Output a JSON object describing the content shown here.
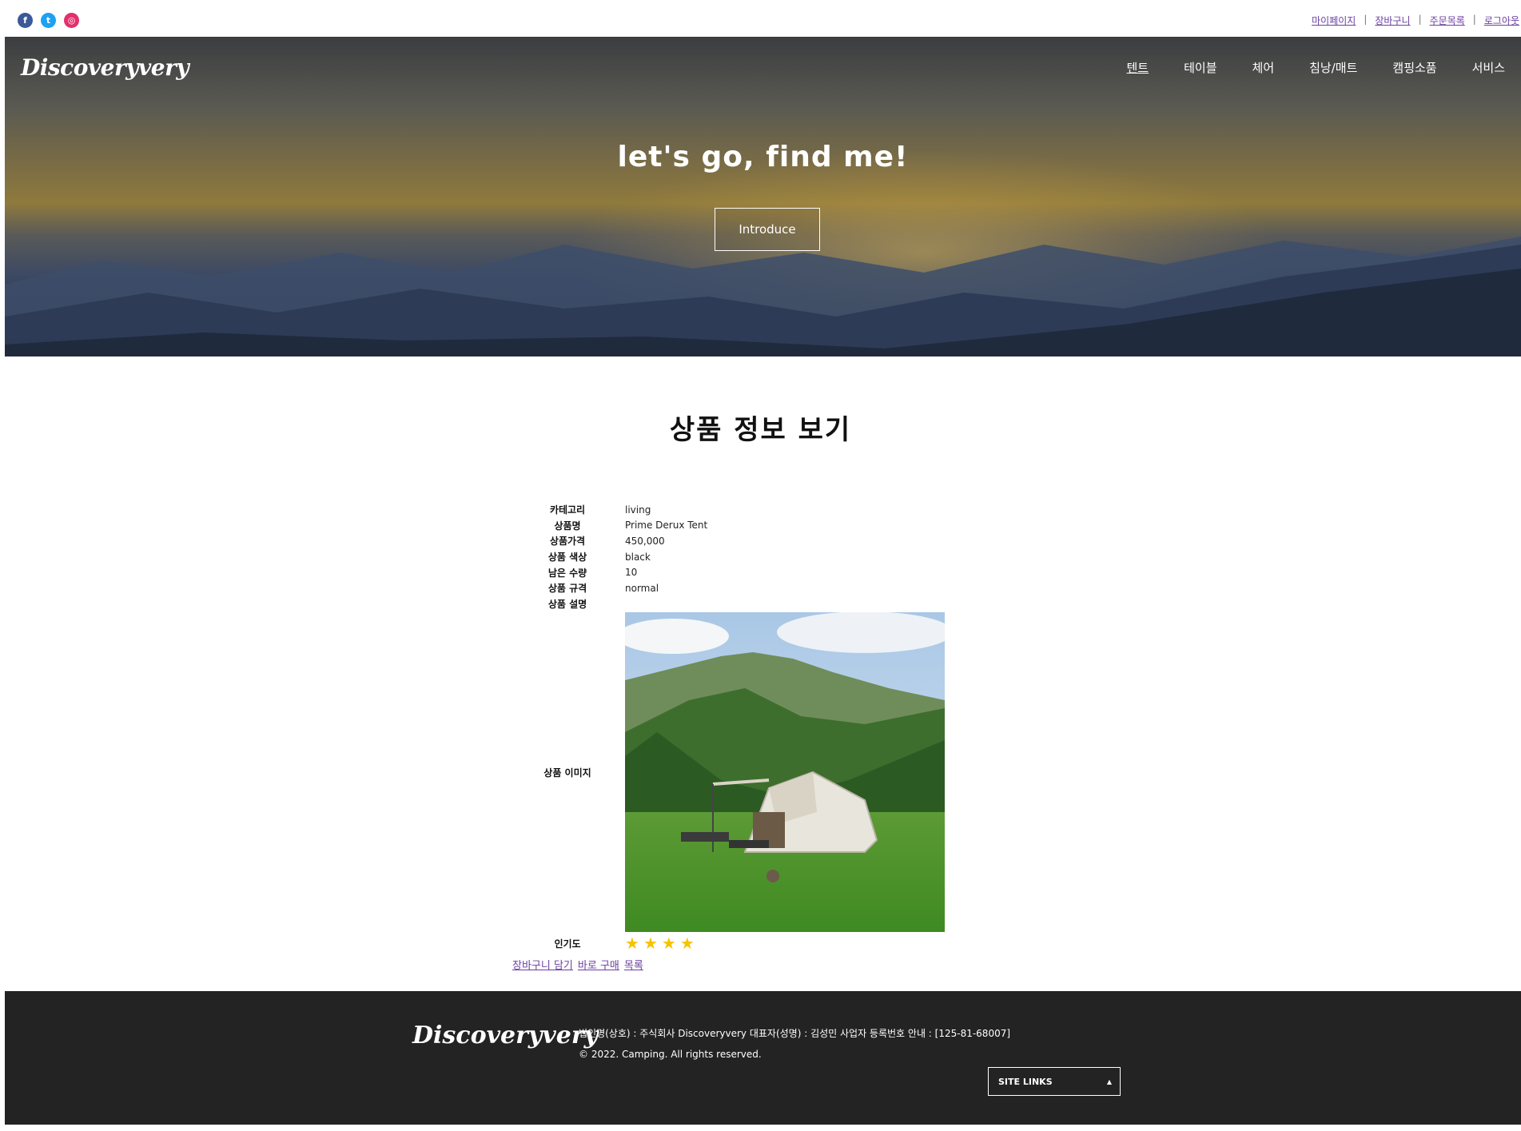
{
  "top": {
    "social": [
      "facebook-icon",
      "twitter-icon",
      "instagram-icon"
    ],
    "links": [
      "마이페이지",
      "장바구니",
      "주문목록",
      "로그아웃"
    ]
  },
  "header": {
    "logo": "Discoveryvery",
    "nav": [
      "텐트",
      "테이블",
      "체어",
      "침낭/매트",
      "캠핑소품",
      "서비스"
    ],
    "active_nav": "텐트",
    "hero_title": "let's go, find me!",
    "hero_button": "Introduce"
  },
  "page": {
    "title": "상품 정보 보기"
  },
  "product": {
    "rows": [
      {
        "label": "카테고리",
        "value": "living"
      },
      {
        "label": "상품명",
        "value": "Prime Derux Tent"
      },
      {
        "label": "상품가격",
        "value": "450,000"
      },
      {
        "label": "상품 색상",
        "value": "black"
      },
      {
        "label": "남은 수량",
        "value": "10"
      },
      {
        "label": "상품 규격",
        "value": "normal"
      },
      {
        "label": "상품 설명",
        "value": ""
      }
    ],
    "image_label": "상품 이미지",
    "popularity_label": "인기도",
    "popularity_stars": 4
  },
  "actions": {
    "cart": "장바구니 담기",
    "buy": "바로 구매",
    "list": "목록"
  },
  "footer": {
    "logo": "Discoveryvery",
    "company": "법인명(상호) : 주식회사 Discoveryvery 대표자(성명) : 김성민 사업자 등록번호 안내 : [125-81-68007]",
    "copyright": "© 2022. Camping. All rights reserved.",
    "site_links": "SITE LINKS"
  },
  "colors": {
    "link": "#6b3fa0",
    "footer_bg": "#232323",
    "star": "#f5c400"
  }
}
